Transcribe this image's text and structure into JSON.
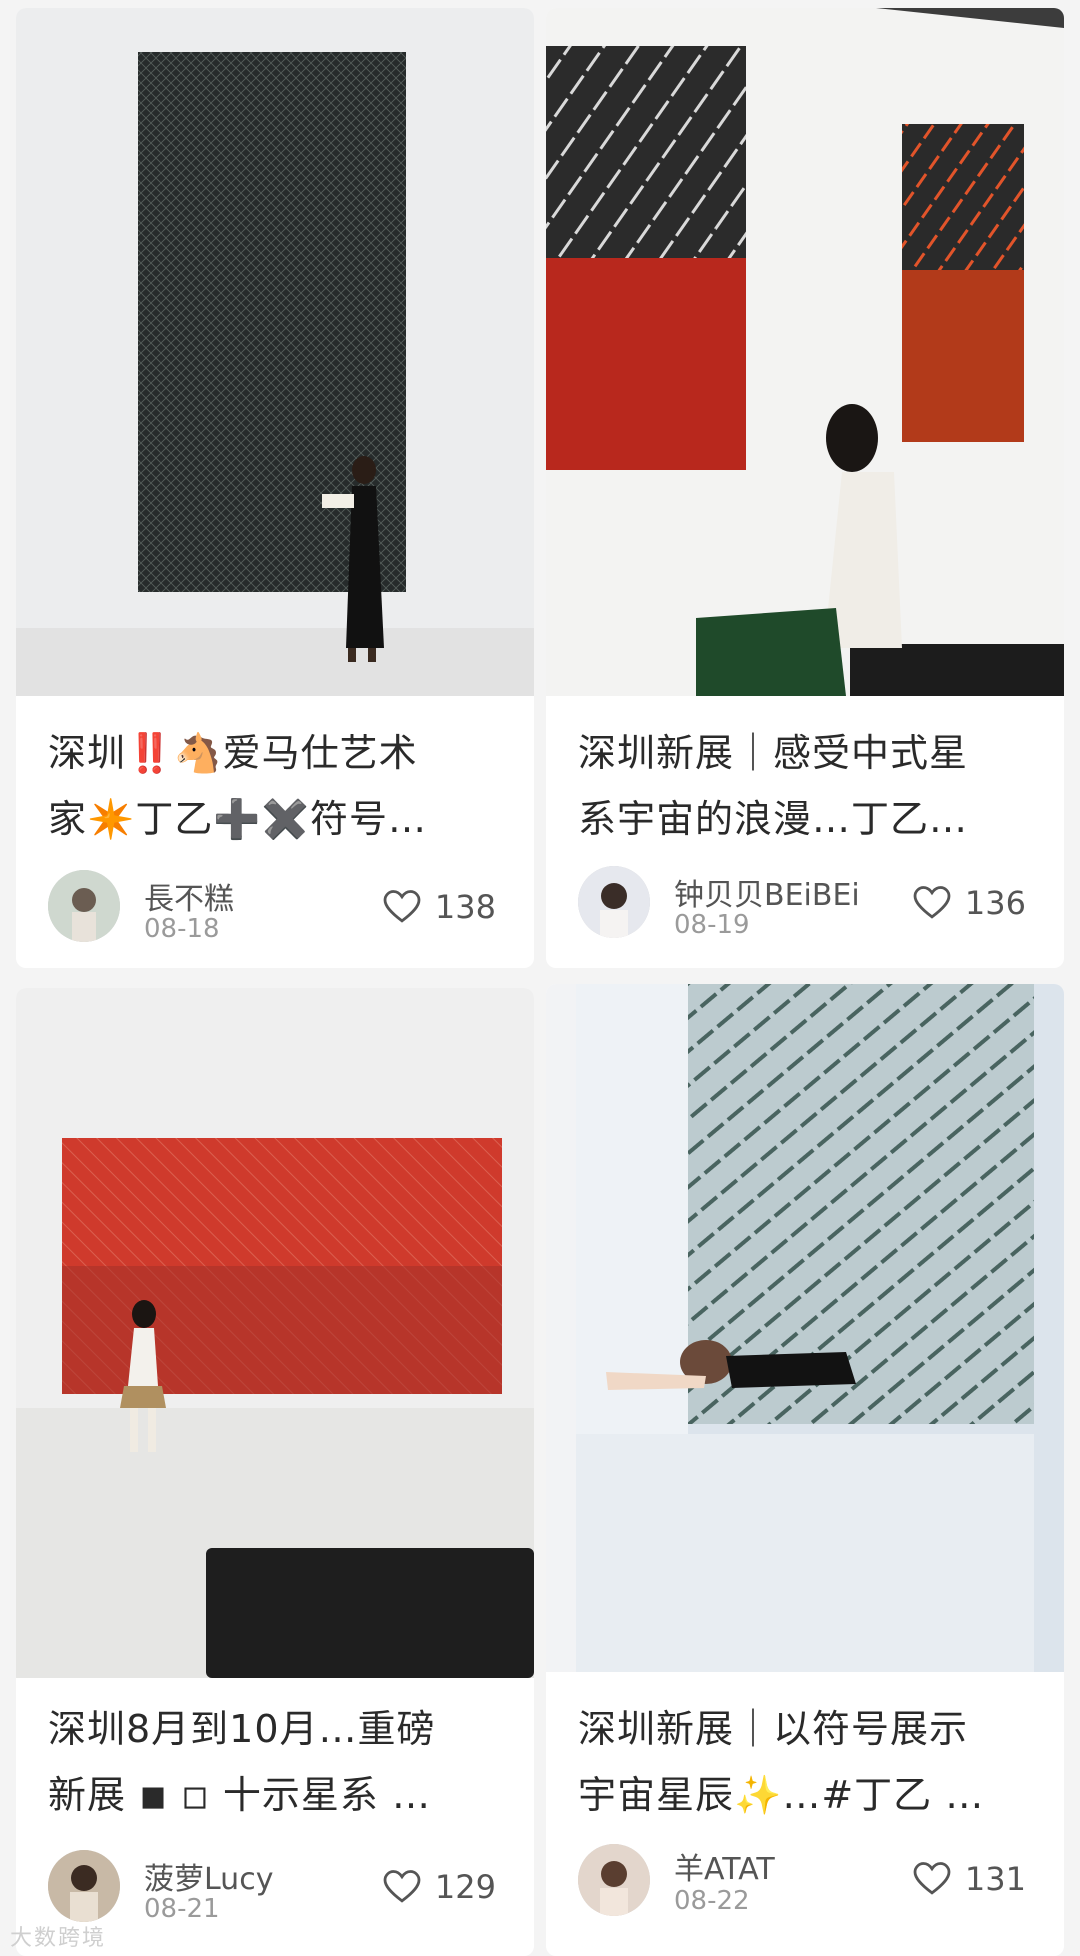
{
  "feed": [
    {
      "title_line1": "深圳‼️🐴爱马仕艺术",
      "title_line2": "家✴️丁乙➕✖️符号…",
      "author": "長不糕",
      "date": "08-18",
      "likes": "138"
    },
    {
      "title_line1": "深圳新展｜感受中式星",
      "title_line2": "系宇宙的浪漫…丁乙…",
      "author": "钟贝贝BEiBEi",
      "date": "08-19",
      "likes": "136"
    },
    {
      "title_line1": "深圳8月到10月…重磅",
      "title_line2": "新展 ◾ ◽ 十示星系 …",
      "author": "菠萝Lucy",
      "date": "08-21",
      "likes": "129"
    },
    {
      "title_line1": "深圳新展｜以符号展示",
      "title_line2": "宇宙星辰✨…#丁乙 …",
      "author": "羊ATAT",
      "date": "08-22",
      "likes": "131"
    }
  ],
  "watermark": "大数跨境",
  "icons": {
    "like": "heart-outline-icon"
  },
  "colors": {
    "background": "#f4f4f4",
    "card": "#ffffff",
    "text": "#2a2a2a",
    "muted": "#9a9a9a"
  }
}
